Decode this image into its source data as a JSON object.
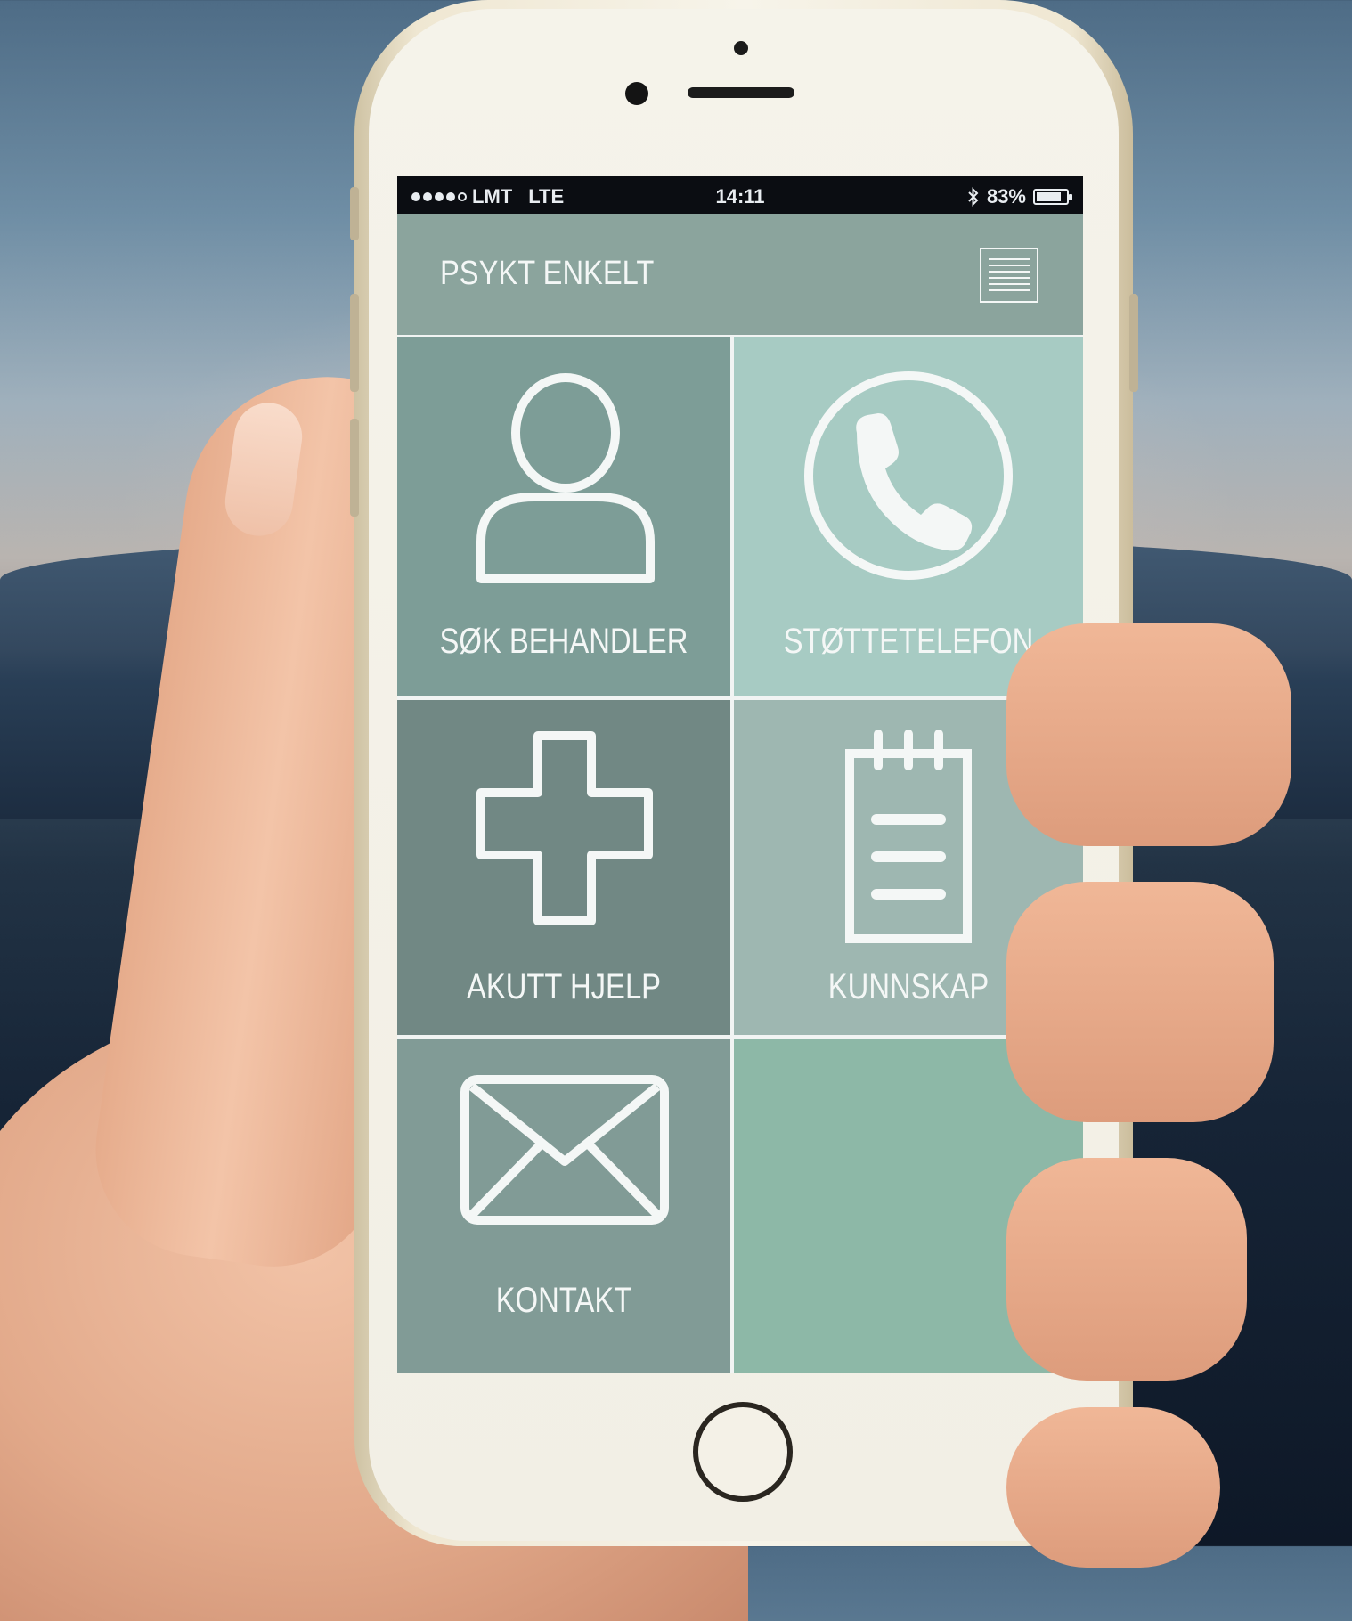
{
  "status_bar": {
    "carrier": "LMT",
    "network": "LTE",
    "time": "14:11",
    "battery": "83%",
    "battery_level": 0.83,
    "signal_dots_filled": 4,
    "signal_dots_total": 5
  },
  "header": {
    "title": "PSYKT ENKELT",
    "menu_icon": "menu-icon"
  },
  "tiles": [
    {
      "label": "SØK BEHANDLER",
      "icon": "person-icon",
      "color": "#7d9d97"
    },
    {
      "label": "STØTTETELEFON",
      "icon": "phone-icon",
      "color": "#a7cbc3"
    },
    {
      "label": "AKUTT HJELP",
      "icon": "plus-icon",
      "color": "#718884"
    },
    {
      "label": "KUNNSKAP",
      "icon": "notepad-icon",
      "color": "#9eb7b1"
    },
    {
      "label": "KONTAKT",
      "icon": "envelope-icon",
      "color": "#819b96"
    },
    {
      "label": "",
      "icon": "",
      "color": "#8db8a7"
    }
  ],
  "colors": {
    "header_bg": "#8ba49d",
    "text": "#f4f7f6",
    "phone_body": "#f5f3ea"
  }
}
